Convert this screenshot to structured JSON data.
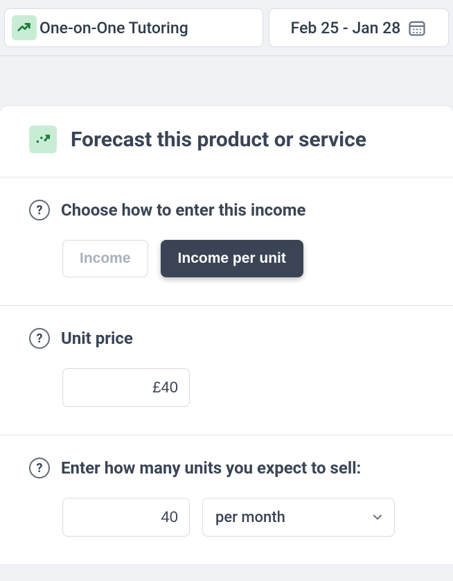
{
  "topbar": {
    "name": "One-on-One Tutoring",
    "date_range": "Feb 25 - Jan 28"
  },
  "panel": {
    "title": "Forecast this product or service"
  },
  "income_method": {
    "label": "Choose how to enter this income",
    "option_income": "Income",
    "option_per_unit": "Income per unit"
  },
  "unit_price": {
    "label": "Unit price",
    "value": "£40"
  },
  "units_expected": {
    "label": "Enter how many units you expect to sell:",
    "value": "40",
    "period": "per month"
  },
  "icons": {
    "help": "?"
  }
}
